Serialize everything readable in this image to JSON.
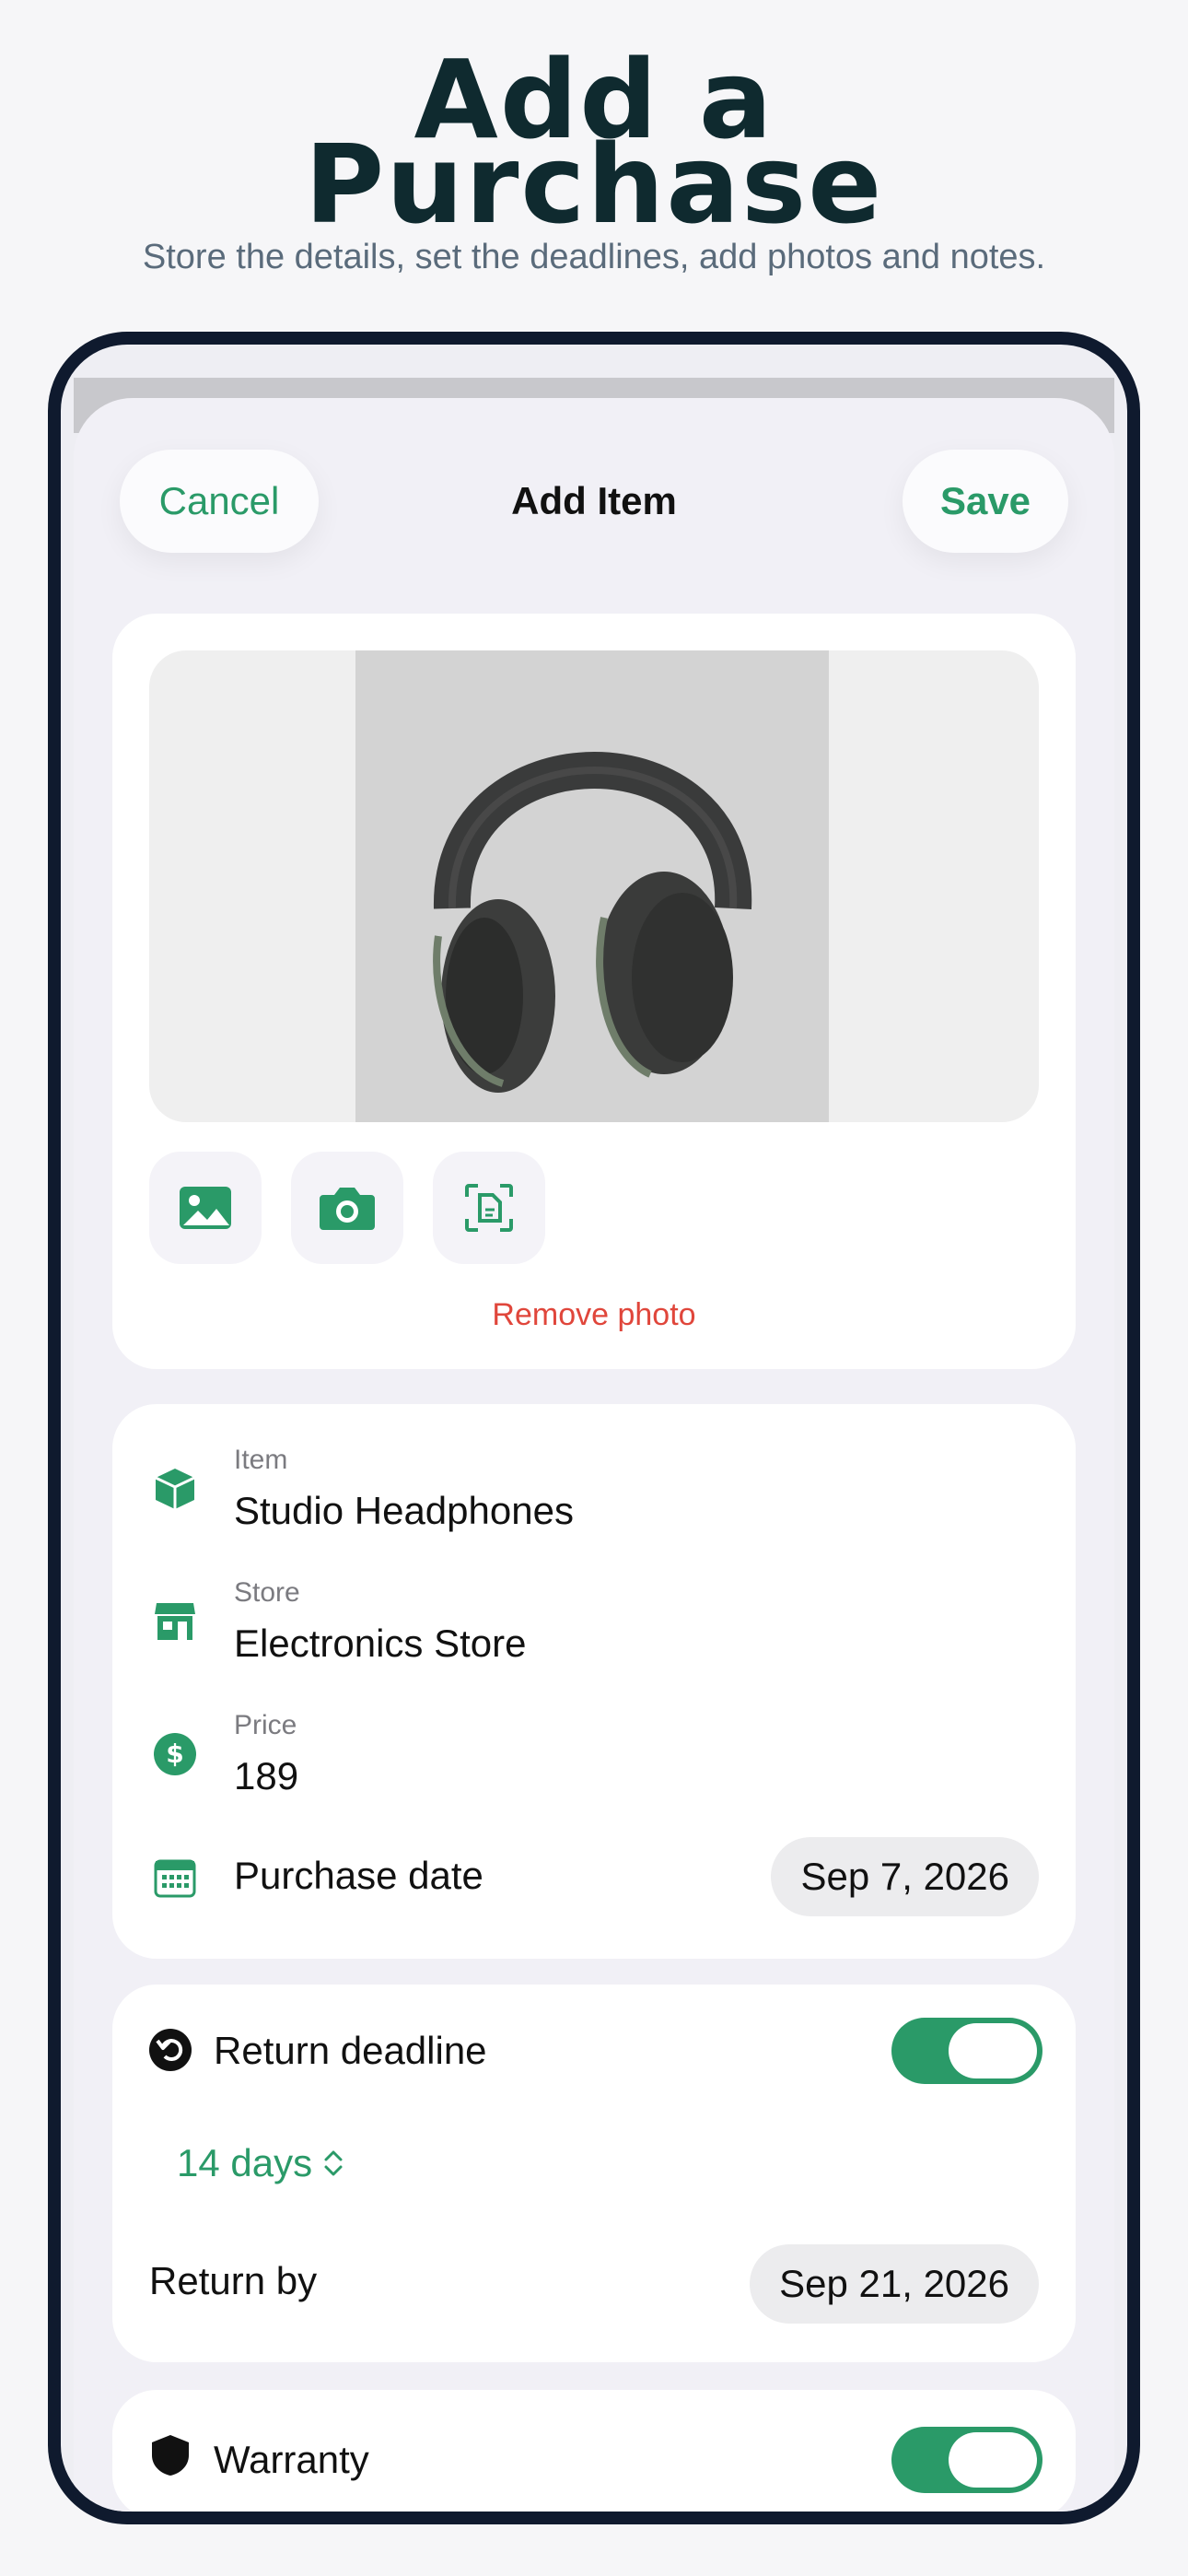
{
  "hero": {
    "title_line1": "Add a",
    "title_line2": "Purchase",
    "subtitle": "Store the details, set the deadlines, add photos and notes."
  },
  "nav": {
    "cancel": "Cancel",
    "title": "Add Item",
    "save": "Save"
  },
  "photo": {
    "remove_label": "Remove photo",
    "tools": [
      "photo-library-icon",
      "camera-icon",
      "document-scan-icon"
    ]
  },
  "details": {
    "item_label": "Item",
    "item_value": "Studio Headphones",
    "store_label": "Store",
    "store_value": "Electronics Store",
    "price_label": "Price",
    "price_value": "189",
    "purchase_date_label": "Purchase date",
    "purchase_date_value": "Sep 7, 2026"
  },
  "return_deadline": {
    "label": "Return deadline",
    "enabled": true,
    "days": "14 days",
    "return_by_label": "Return by",
    "return_by_value": "Sep 21, 2026"
  },
  "warranty": {
    "label": "Warranty",
    "enabled": true
  },
  "colors": {
    "accent": "#2a9a68",
    "destructive": "#e0463b",
    "title": "#0f2a2f"
  }
}
